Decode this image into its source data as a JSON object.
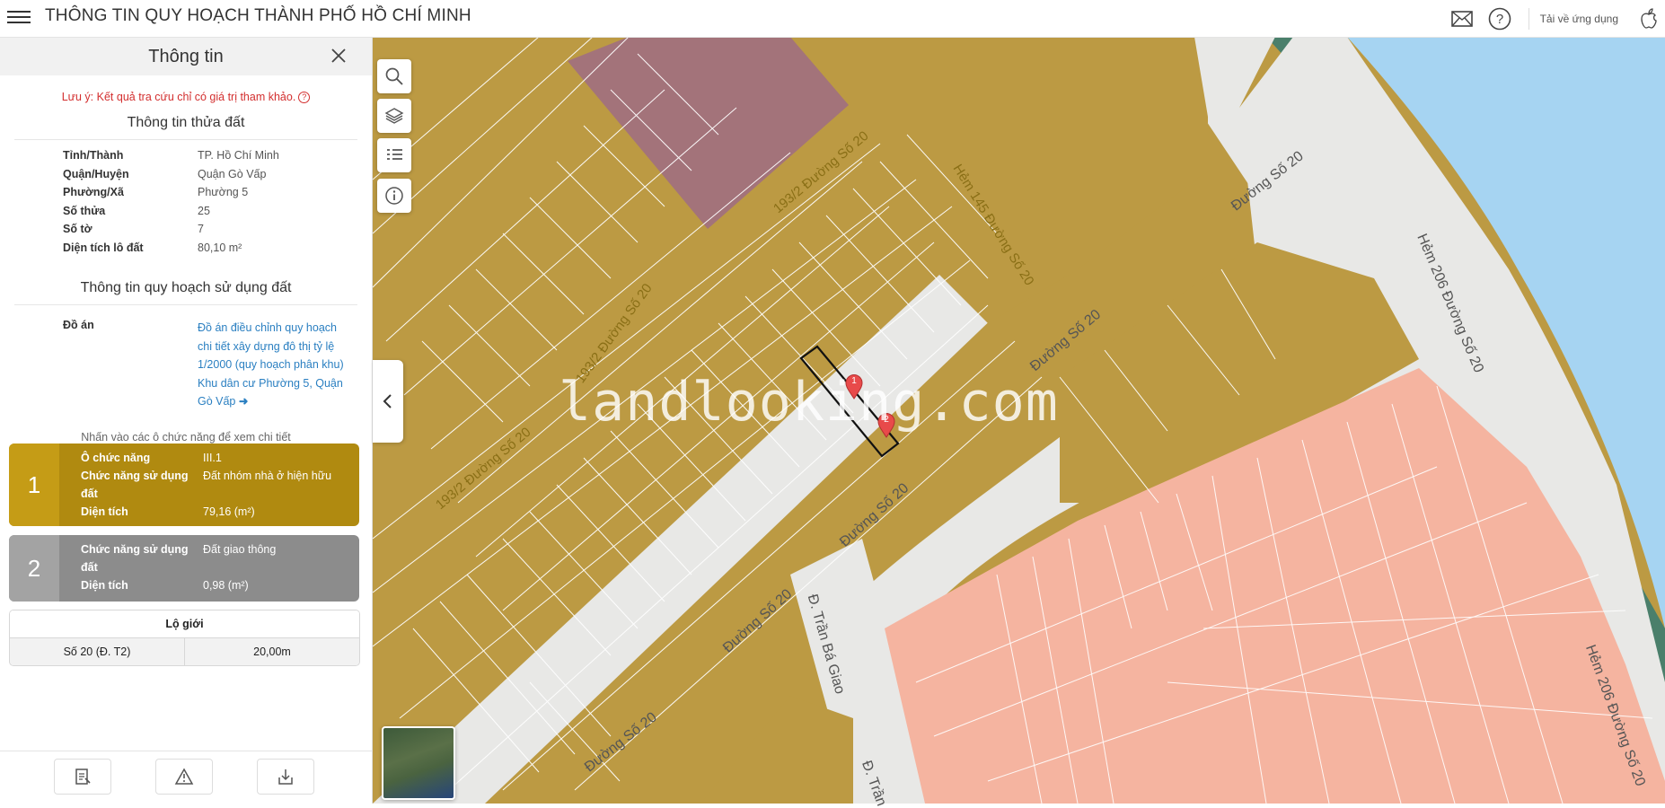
{
  "header": {
    "title": "THÔNG TIN QUY HOẠCH THÀNH PHỐ HỒ CHÍ MINH",
    "download_label": "Tải về ứng dụng"
  },
  "panel": {
    "title": "Thông tin",
    "note": "Lưu ý: Kết quả tra cứu chỉ có giá trị tham khảo.",
    "parcel_section_title": "Thông tin thửa đất",
    "parcel": [
      {
        "label": "Tỉnh/Thành",
        "value": "TP. Hồ Chí Minh"
      },
      {
        "label": "Quận/Huyện",
        "value": "Quận Gò Vấp"
      },
      {
        "label": "Phường/Xã",
        "value": "Phường 5"
      },
      {
        "label": "Số thửa",
        "value": "25"
      },
      {
        "label": "Số tờ",
        "value": "7"
      },
      {
        "label": "Diện tích lô đất",
        "value": "80,10 m²"
      }
    ],
    "plan_section_title": "Thông tin quy hoạch sử dụng đất",
    "plan_label": "Đồ án",
    "plan_value": "Đồ án điều chỉnh quy hoạch chi tiết xây dựng đô thị tỷ lệ 1/2000 (quy hoạch phân khu) Khu dân cư Phường 5, Quận Gò Vấp",
    "hint": "Nhấn vào các ô chức năng để xem chi tiết",
    "functions": [
      {
        "num": "1",
        "color": "#b08a10",
        "rows": [
          {
            "k": "Ô chức năng",
            "v": "III.1"
          },
          {
            "k": "Chức năng sử dụng đất",
            "v": "Đất nhóm nhà ở hiện hữu"
          },
          {
            "k": "Diện tích",
            "v": "79,16 (m²)"
          }
        ]
      },
      {
        "num": "2",
        "color": "#8c8c8c",
        "rows": [
          {
            "k": "Chức năng sử dụng đất",
            "v": "Đất giao thông"
          },
          {
            "k": "Diện tích",
            "v": "0,98 (m²)"
          }
        ]
      }
    ],
    "lo_gioi": {
      "title": "Lộ giới",
      "street": "Số 20 (Đ. T2)",
      "width": "20,00m"
    }
  },
  "map": {
    "watermark": "landlooking.com",
    "labels": {
      "s1": "193/2 Đường Số 20",
      "s2": "193/2 Đường Số 20",
      "s3": "193/2 Đường Số 20",
      "s4": "Hẻm 145 Đường Số 20",
      "s5": "Đường Số 20",
      "s6": "Đường Số 20",
      "s7": "Đường Số 20",
      "s8": "Đường Số 20",
      "s9": "Đường Số 20",
      "s10": "Hẻm 206 Đường Số 20",
      "s11": "Đ. Trần Bá Giao",
      "s12": "Đ. Trần",
      "s13": "Hẻm 206 Đường Số 20"
    },
    "marker1": "1",
    "marker2": "2",
    "colors": {
      "residential": "#bc9a43",
      "road": "#e6e6e6",
      "water": "#a6d4f2",
      "green": "#4a7f6b",
      "pink": "#f5b4a0",
      "mauve": "#a3737a"
    }
  }
}
